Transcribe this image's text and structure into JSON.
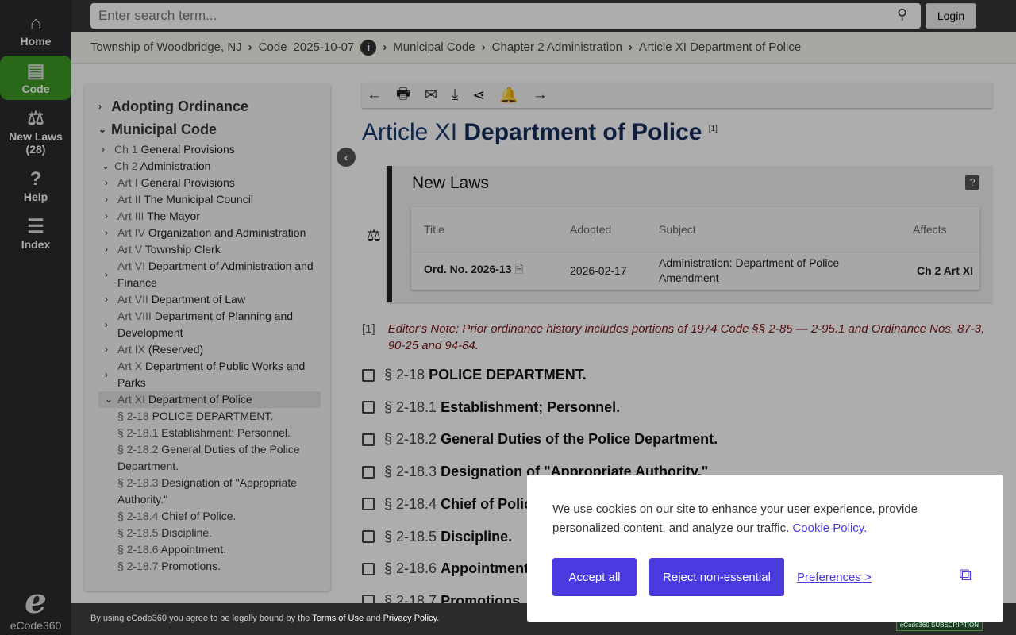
{
  "nav": [
    {
      "label": "Home",
      "icon": "⌂"
    },
    {
      "label": "Code",
      "icon": "▤"
    },
    {
      "label": "New Laws",
      "count": "(28)",
      "icon": "⚖"
    },
    {
      "label": "Help",
      "icon": "?"
    },
    {
      "label": "Index",
      "icon": "☰"
    }
  ],
  "logo": {
    "text": "eCode360"
  },
  "header": {
    "search_placeholder": "Enter search term...",
    "login": "Login"
  },
  "breadcrumb": {
    "muni": "Township of Woodbridge, NJ",
    "code": "Code",
    "date": "2025-10-07",
    "items": [
      "Municipal Code",
      "Chapter 2 Administration",
      "Article XI Department of Police"
    ]
  },
  "tree": {
    "top": [
      "Adopting Ordinance",
      "Municipal Code"
    ],
    "ch": [
      {
        "n": "Ch 1",
        "t": "General Provisions",
        "c": "›"
      },
      {
        "n": "Ch 2",
        "t": "Administration",
        "c": "⌄"
      }
    ],
    "arts": [
      {
        "n": "Art I",
        "t": "General Provisions"
      },
      {
        "n": "Art II",
        "t": "The Municipal Council"
      },
      {
        "n": "Art III",
        "t": "The Mayor"
      },
      {
        "n": "Art IV",
        "t": "Organization and Administration"
      },
      {
        "n": "Art V",
        "t": "Township Clerk"
      },
      {
        "n": "Art VI",
        "t": "Department of Administration and Finance"
      },
      {
        "n": "Art VII",
        "t": "Department of Law"
      },
      {
        "n": "Art VIII",
        "t": "Department of Planning and Development"
      },
      {
        "n": "Art IX",
        "t": "(Reserved)"
      },
      {
        "n": "Art X",
        "t": "Department of Public Works and Parks"
      },
      {
        "n": "Art XI",
        "t": "Department of Police"
      }
    ],
    "secs": [
      {
        "n": "§ 2-18",
        "t": "POLICE DEPARTMENT."
      },
      {
        "n": "§ 2-18.1",
        "t": "Establishment; Personnel."
      },
      {
        "n": "§ 2-18.2",
        "t": "General Duties of the Police Department."
      },
      {
        "n": "§ 2-18.3",
        "t": "Designation of \"Appropriate Authority.\""
      },
      {
        "n": "§ 2-18.4",
        "t": "Chief of Police."
      },
      {
        "n": "§ 2-18.5",
        "t": "Discipline."
      },
      {
        "n": "§ 2-18.6",
        "t": "Appointment."
      },
      {
        "n": "§ 2-18.7",
        "t": "Promotions."
      }
    ]
  },
  "toolbar": [
    "←",
    "🖶",
    "✉",
    "⤓",
    "⋖",
    "🔔",
    "→"
  ],
  "article": {
    "prefix": "Article XI",
    "title": "Department of Police",
    "fn": "[1]"
  },
  "newlaws": {
    "heading": "New Laws",
    "help": "?",
    "cols": [
      "Title",
      "Adopted",
      "Subject",
      "Affects"
    ],
    "row": {
      "title": "Ord. No. 2026-13",
      "adopted": "2026-02-17",
      "subject": "Administration: Department of Police Amendment",
      "affects": "Ch 2 Art XI"
    }
  },
  "note": {
    "marker": "[1]",
    "text": "Editor's Note: Prior ordinance history includes portions of 1974 Code §§ 2-85 — 2-95.1 and Ordinance Nos. 87-3, 90-25 and 94-84."
  },
  "sections": [
    {
      "n": "§ 2-18",
      "t": "POLICE DEPARTMENT."
    },
    {
      "n": "§ 2-18.1",
      "t": "Establishment; Personnel."
    },
    {
      "n": "§ 2-18.2",
      "t": "General Duties of the Police Department."
    },
    {
      "n": "§ 2-18.3",
      "t": "Designation of \"Appropriate Authority.\""
    },
    {
      "n": "§ 2-18.4",
      "t": "Chief of Police."
    },
    {
      "n": "§ 2-18.5",
      "t": "Discipline."
    },
    {
      "n": "§ 2-18.6",
      "t": "Appointment."
    },
    {
      "n": "§ 2-18.7",
      "t": "Promotions."
    }
  ],
  "footer": {
    "pre": "By using eCode360 you agree to be legally bound by the",
    "terms": "Terms of Use",
    "and": "and",
    "privacy": "Privacy Policy",
    "badge": "eCode360 SUBSCRIPTION"
  },
  "cookie": {
    "text": "We use cookies on our site to enhance your user experience, provide personalized content, and analyze our traffic.",
    "policy": "Cookie Policy.",
    "accept": "Accept all",
    "reject": "Reject non-essential",
    "prefs": "Preferences >",
    "logo": "⧉"
  }
}
